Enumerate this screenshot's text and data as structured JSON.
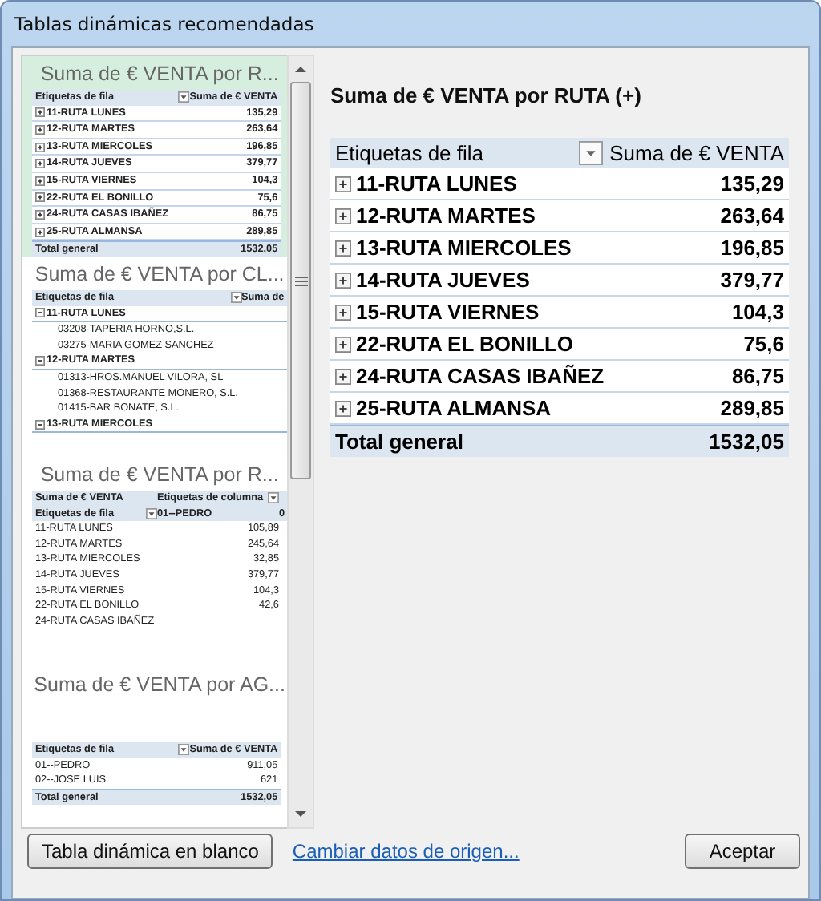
{
  "window": {
    "title": "Tablas dinámicas recomendadas"
  },
  "previews": [
    {
      "kind": "simple",
      "selected": true,
      "title": "Suma de  € VENTA por  R...",
      "rows": [
        {
          "kind": "header",
          "cells": [
            {
              "text": "Etiquetas de fila",
              "filter": true
            },
            {
              "text": "Suma de  € VENTA",
              "filter": false
            }
          ]
        },
        {
          "kind": "item",
          "cells": [
            "11-RUTA LUNES",
            "135,29"
          ]
        },
        {
          "kind": "item",
          "cells": [
            "12-RUTA MARTES",
            "263,64"
          ]
        },
        {
          "kind": "item",
          "cells": [
            "13-RUTA MIERCOLES",
            "196,85"
          ]
        },
        {
          "kind": "item",
          "cells": [
            "14-RUTA JUEVES",
            "379,77"
          ]
        },
        {
          "kind": "item",
          "cells": [
            "15-RUTA VIERNES",
            "104,3"
          ]
        },
        {
          "kind": "item",
          "cells": [
            "22-RUTA EL BONILLO",
            "75,6"
          ]
        },
        {
          "kind": "item",
          "cells": [
            "24-RUTA CASAS IBAÑEZ",
            "86,75"
          ]
        },
        {
          "kind": "item",
          "cells": [
            "25-RUTA ALMANSA",
            "289,85"
          ]
        },
        {
          "kind": "total",
          "cells": [
            "Total general",
            "1532,05"
          ]
        }
      ]
    },
    {
      "kind": "grouped",
      "selected": false,
      "title": "Suma de  € VENTA por CL...",
      "rows": [
        {
          "kind": "header",
          "cells": [
            {
              "text": "Etiquetas de fila",
              "filter": true
            },
            {
              "text": "Suma de",
              "filter": false
            }
          ]
        },
        {
          "kind": "group",
          "cells": [
            "11-RUTA LUNES"
          ]
        },
        {
          "kind": "child",
          "cells": [
            "03208-TAPERIA HORNO,S.L."
          ]
        },
        {
          "kind": "child",
          "cells": [
            "03275-MARIA GOMEZ SANCHEZ"
          ]
        },
        {
          "kind": "group",
          "cells": [
            "12-RUTA MARTES"
          ]
        },
        {
          "kind": "child",
          "cells": [
            "01313-HROS.MANUEL VILORA, SL"
          ]
        },
        {
          "kind": "child",
          "cells": [
            "01368-RESTAURANTE MONERO, S.L."
          ]
        },
        {
          "kind": "child",
          "cells": [
            "01415-BAR BONATE, S.L."
          ]
        },
        {
          "kind": "group",
          "cells": [
            "13-RUTA MIERCOLES"
          ]
        }
      ]
    },
    {
      "kind": "crosstab",
      "selected": false,
      "title": "Suma de  € VENTA por  R...",
      "rows": [
        {
          "kind": "header",
          "cells": [
            {
              "text": "Suma de  € VENTA",
              "filter": false
            },
            {
              "text": "Etiquetas de columna",
              "filter": true
            }
          ]
        },
        {
          "kind": "header",
          "cells": [
            {
              "text": "Etiquetas de fila",
              "filter": true
            },
            {
              "text": "01--PEDRO",
              "filter": false
            },
            "0"
          ]
        },
        {
          "kind": "plain",
          "cells": [
            "11-RUTA LUNES",
            "105,89"
          ]
        },
        {
          "kind": "plain",
          "cells": [
            "12-RUTA MARTES",
            "245,64"
          ]
        },
        {
          "kind": "plain",
          "cells": [
            "13-RUTA MIERCOLES",
            "32,85"
          ]
        },
        {
          "kind": "plain",
          "cells": [
            "14-RUTA JUEVES",
            "379,77"
          ]
        },
        {
          "kind": "plain",
          "cells": [
            "15-RUTA VIERNES",
            "104,3"
          ]
        },
        {
          "kind": "plain",
          "cells": [
            "22-RUTA EL BONILLO",
            "42,6"
          ]
        },
        {
          "kind": "plain",
          "cells": [
            "24-RUTA CASAS IBAÑEZ"
          ]
        }
      ]
    },
    {
      "kind": "simple",
      "selected": false,
      "title": "Suma de  € VENTA por AG...",
      "rows": [
        {
          "kind": "header",
          "cells": [
            {
              "text": "Etiquetas de fila",
              "filter": true
            },
            {
              "text": "Suma de  € VENTA",
              "filter": false
            }
          ]
        },
        {
          "kind": "plain",
          "cells": [
            "01--PEDRO",
            "911,05"
          ]
        },
        {
          "kind": "plain",
          "cells": [
            "02--JOSE LUIS",
            "621"
          ]
        },
        {
          "kind": "total",
          "cells": [
            "Total general",
            "1532,05"
          ]
        }
      ]
    }
  ],
  "detail": {
    "title": "Suma de  € VENTA por  RUTA (+)",
    "rows": [
      {
        "kind": "header",
        "cells": [
          {
            "text": "Etiquetas de fila",
            "filter": true
          },
          {
            "text": "Suma de  € VENTA",
            "filter": false
          }
        ]
      },
      {
        "kind": "item",
        "cells": [
          "11-RUTA LUNES",
          "135,29"
        ]
      },
      {
        "kind": "item",
        "cells": [
          "12-RUTA MARTES",
          "263,64"
        ]
      },
      {
        "kind": "item",
        "cells": [
          "13-RUTA MIERCOLES",
          "196,85"
        ]
      },
      {
        "kind": "item",
        "cells": [
          "14-RUTA JUEVES",
          "379,77"
        ]
      },
      {
        "kind": "item",
        "cells": [
          "15-RUTA VIERNES",
          "104,3"
        ]
      },
      {
        "kind": "item",
        "cells": [
          "22-RUTA EL BONILLO",
          "75,6"
        ]
      },
      {
        "kind": "item",
        "cells": [
          "24-RUTA CASAS IBAÑEZ",
          "86,75"
        ]
      },
      {
        "kind": "item",
        "cells": [
          "25-RUTA ALMANSA",
          "289,85"
        ]
      },
      {
        "kind": "total",
        "cells": [
          "Total general",
          "1532,05"
        ]
      }
    ]
  },
  "footer": {
    "blank_button": "Tabla dinámica en blanco",
    "link": "Cambiar datos de origen...",
    "ok_button": "Aceptar"
  }
}
